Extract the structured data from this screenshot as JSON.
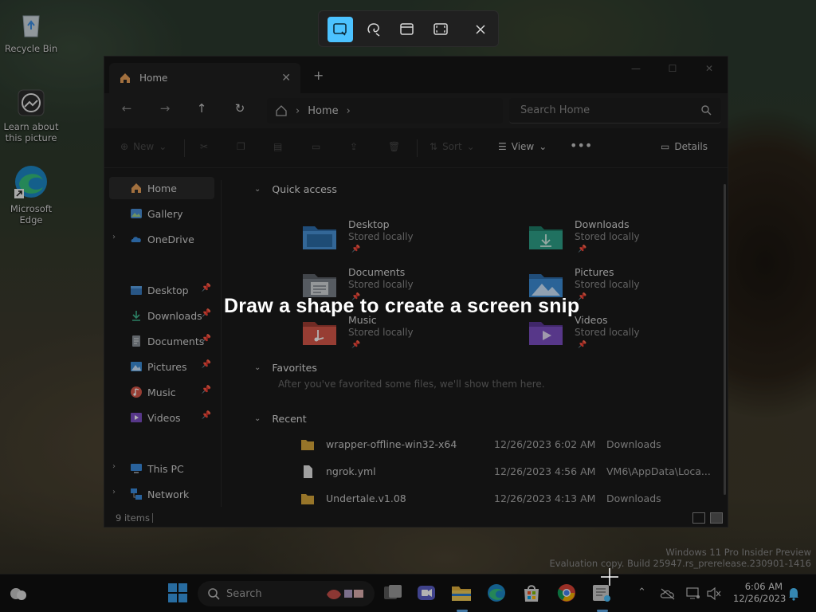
{
  "desktop": {
    "icons": [
      {
        "label": "Recycle Bin",
        "icon": "recycle-bin-icon"
      },
      {
        "label": "Learn about this picture",
        "icon": "spotlight-icon"
      },
      {
        "label": "Microsoft Edge",
        "icon": "edge-icon"
      }
    ]
  },
  "snip": {
    "hint": "Draw a shape to create a screen snip",
    "modes": [
      "rectangle-snip-icon",
      "freeform-snip-icon",
      "window-snip-icon",
      "fullscreen-snip-icon",
      "close-icon"
    ]
  },
  "explorer": {
    "tab_title": "Home",
    "address": {
      "location": "Home"
    },
    "search": {
      "placeholder": "Search Home"
    },
    "commands": {
      "new": "New",
      "sort": "Sort",
      "view": "View",
      "details": "Details"
    },
    "sidebar": {
      "items": [
        {
          "label": "Home"
        },
        {
          "label": "Gallery"
        },
        {
          "label": "OneDrive"
        },
        {
          "label": "Desktop"
        },
        {
          "label": "Downloads"
        },
        {
          "label": "Documents"
        },
        {
          "label": "Pictures"
        },
        {
          "label": "Music"
        },
        {
          "label": "Videos"
        },
        {
          "label": "This PC"
        },
        {
          "label": "Network"
        }
      ]
    },
    "sections": {
      "quick_access": "Quick access",
      "favorites": "Favorites",
      "recent": "Recent",
      "favorites_hint": "After you've favorited some files, we'll show them here."
    },
    "quick_access": [
      {
        "name": "Desktop",
        "sub": "Stored locally"
      },
      {
        "name": "Downloads",
        "sub": "Stored locally"
      },
      {
        "name": "Documents",
        "sub": "Stored locally"
      },
      {
        "name": "Pictures",
        "sub": "Stored locally"
      },
      {
        "name": "Music",
        "sub": "Stored locally"
      },
      {
        "name": "Videos",
        "sub": "Stored locally"
      }
    ],
    "recent": [
      {
        "name": "wrapper-offline-win32-x64",
        "date": "12/26/2023 6:02 AM",
        "location": "Downloads"
      },
      {
        "name": "ngrok.yml",
        "date": "12/26/2023 4:56 AM",
        "location": "VM6\\AppData\\Loca..."
      },
      {
        "name": "Undertale.v1.08",
        "date": "12/26/2023 4:13 AM",
        "location": "Downloads"
      }
    ],
    "status": {
      "count": "9 items"
    }
  },
  "watermark": {
    "line1": "Windows 11 Pro Insider Preview",
    "line2": "Evaluation copy. Build 25947.rs_prerelease.230901-1416"
  },
  "taskbar": {
    "search_placeholder": "Search",
    "clock": {
      "time": "6:06 AM",
      "date": "12/26/2023"
    }
  },
  "colors": {
    "accent": "#4cc2ff",
    "folder_yellow": "#d9a83c",
    "folder_blue": "#3d8fd8",
    "folder_teal": "#2ea38a"
  }
}
